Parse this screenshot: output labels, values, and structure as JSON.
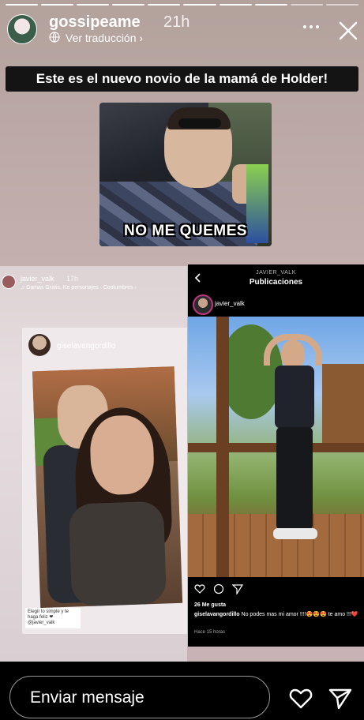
{
  "header": {
    "username": "gossipeame",
    "time": "21h",
    "translate_label": "Ver traducción",
    "translate_chevron": "›"
  },
  "story": {
    "headline": "Este es el nuevo novio de la mamá de Holder!",
    "meme_caption": "NO ME QUEMES"
  },
  "left_screenshot": {
    "username": "javier_valk",
    "time": "17h",
    "music": "♫ Damas Gratis, Ke personajes · Costumbres ›",
    "tagged_user": "giselavangordillo",
    "note_line1": "Elegir lo simple y te haga feliz ❤",
    "note_line2": "@javier_valk"
  },
  "right_screenshot": {
    "account_small": "JAVIER_VALK",
    "title": "Publicaciones",
    "username": "javier_valk",
    "likes": "26 Me gusta",
    "caption_user": "giselavangordillo",
    "caption_text": "No podes mas mi amor !!!!😍😍😍 te amo !!!❤️",
    "time_ago": "Hace 15 horas"
  },
  "footer": {
    "message_placeholder": "Enviar mensaje"
  },
  "icons": {
    "more": "more-icon",
    "close": "close-icon",
    "heart": "heart-icon",
    "send": "send-icon"
  }
}
